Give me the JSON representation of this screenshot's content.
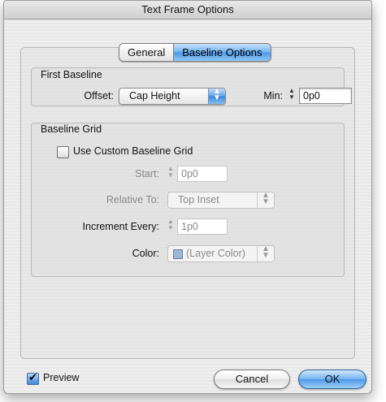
{
  "window": {
    "title": "Text Frame Options"
  },
  "tabs": [
    {
      "label": "General",
      "selected": false
    },
    {
      "label": "Baseline Options",
      "selected": true
    }
  ],
  "first_baseline": {
    "title": "First Baseline",
    "offset_label": "Offset:",
    "offset_value": "Cap Height",
    "min_label": "Min:",
    "min_value": "0p0"
  },
  "baseline_grid": {
    "title": "Baseline Grid",
    "use_custom_label": "Use Custom Baseline Grid",
    "use_custom_checked": false,
    "start_label": "Start:",
    "start_value": "0p0",
    "relative_label": "Relative To:",
    "relative_value": "Top Inset",
    "increment_label": "Increment Every:",
    "increment_value": "1p0",
    "color_label": "Color:",
    "color_value": "(Layer Color)"
  },
  "footer": {
    "preview_label": "Preview",
    "preview_checked": true,
    "cancel_label": "Cancel",
    "ok_label": "OK"
  },
  "colors": {
    "accent": "#4f98e6",
    "layer_swatch": "#9cb7d6"
  }
}
